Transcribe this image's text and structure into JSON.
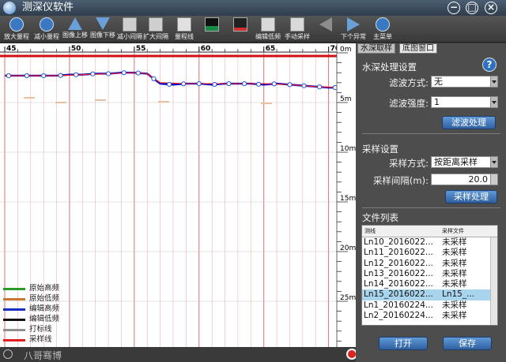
{
  "window": {
    "title": "测深仪软件",
    "controls": {
      "minimize": "−",
      "maximize": "□",
      "close": "×"
    }
  },
  "toolbar": [
    {
      "label": "放大量程",
      "icon": "zoom-in-icon"
    },
    {
      "label": "减小量程",
      "icon": "zoom-out-icon"
    },
    {
      "label": "图像上移",
      "icon": "arrow-up-icon"
    },
    {
      "label": "图像下移",
      "icon": "arrow-down-icon"
    },
    {
      "label": "减小间隔",
      "icon": "shrink-interval-icon"
    },
    {
      "label": "扩大间隔",
      "icon": "expand-interval-icon"
    },
    {
      "label": "量程线",
      "icon": "range-line-icon"
    },
    {
      "label": "",
      "icon": "waveform-icon"
    },
    {
      "label": "",
      "icon": "edit-line-icon"
    },
    {
      "label": "编辑低频",
      "icon": "edit-low-freq-icon"
    },
    {
      "label": "手动采样",
      "icon": "manual-sample-icon"
    },
    {
      "label": "",
      "icon": "prev-arrow-icon"
    },
    {
      "label": "下个异常",
      "icon": "next-arrow-icon"
    },
    {
      "label": "主菜单",
      "icon": "main-menu-icon"
    }
  ],
  "chart_data": {
    "type": "line",
    "title": "",
    "xlabel": "",
    "ylabel": "",
    "x_ticks": [
      "45",
      "50",
      "55",
      "60",
      "65",
      "70"
    ],
    "xlim": [
      45,
      71
    ],
    "depth_ticks": [
      "0m",
      "5m",
      "10m",
      "15m",
      "20m",
      "25m"
    ],
    "ylim": [
      0,
      30
    ],
    "grid": true,
    "series": [
      {
        "name": "编辑高频",
        "color": "#0000cc",
        "x": [
          45,
          46,
          47,
          48,
          49,
          50,
          51,
          52,
          53,
          54,
          55,
          56,
          57,
          58,
          59,
          60,
          61,
          62,
          63,
          64,
          65,
          66,
          67,
          68,
          69,
          70,
          71
        ],
        "y": [
          2.3,
          2.3,
          2.3,
          2.3,
          2.3,
          2.2,
          2.2,
          2.1,
          2.1,
          2.0,
          2.0,
          2.1,
          3.1,
          3.2,
          3.1,
          3.1,
          3.2,
          3.1,
          3.1,
          3.1,
          3.2,
          3.1,
          3.2,
          3.3,
          3.4,
          3.5,
          3.5
        ]
      },
      {
        "name": "采样线",
        "color": "#ee2222",
        "x": [
          45,
          47,
          49,
          51,
          53,
          55,
          56,
          57,
          59,
          61,
          63,
          65,
          67,
          69,
          71
        ],
        "y": [
          2.3,
          2.3,
          2.3,
          2.2,
          2.1,
          2.0,
          2.1,
          3.0,
          3.1,
          3.1,
          3.1,
          3.1,
          3.2,
          3.4,
          3.5
        ]
      }
    ],
    "sample_marks_x": [
      45.3,
      46.7,
      48.0,
      49.3,
      50.5,
      51.8,
      53.0,
      54.2,
      55.3,
      56.5,
      57.7,
      58.8,
      60.0,
      61.2,
      62.3,
      63.5,
      64.6,
      65.8,
      67.0,
      68.1,
      69.3,
      70.5
    ],
    "legend": [
      {
        "name": "原始高频",
        "color": "#2a9a2a"
      },
      {
        "name": "原始低频",
        "color": "#c87830"
      },
      {
        "name": "编辑高频",
        "color": "#1030c0"
      },
      {
        "name": "编辑低频",
        "color": "#101010"
      },
      {
        "name": "打标线",
        "color": "#909090"
      },
      {
        "name": "采样线",
        "color": "#e02020"
      }
    ]
  },
  "status": {
    "text": "八哥骞博"
  },
  "panel": {
    "tabs": [
      {
        "label": "水深取样",
        "active": true
      },
      {
        "label": "底图窗口",
        "active": false
      }
    ],
    "water": {
      "section": "水深处理设置",
      "filter_mode_label": "滤波方式:",
      "filter_mode_value": "无",
      "filter_strength_label": "滤波强度:",
      "filter_strength_value": "1",
      "process_button": "滤波处理"
    },
    "sample": {
      "section": "采样设置",
      "method_label": "采样方式:",
      "method_value": "按距离采样",
      "interval_label": "采样间隔(m):",
      "interval_value": "20.0",
      "process_button": "采样处理"
    },
    "files": {
      "section": "文件列表",
      "col1": "测线",
      "col2": "采样文件",
      "rows": [
        {
          "line": "Ln10_2016022...",
          "sample": "未采样",
          "selected": false
        },
        {
          "line": "Ln11_2016022...",
          "sample": "未采样",
          "selected": false
        },
        {
          "line": "Ln12_2016022...",
          "sample": "未采样",
          "selected": false
        },
        {
          "line": "Ln13_2016022...",
          "sample": "未采样",
          "selected": false
        },
        {
          "line": "Ln14_2016022...",
          "sample": "未采样",
          "selected": false
        },
        {
          "line": "Ln15_2016022...",
          "sample": "Ln15_...",
          "selected": true
        },
        {
          "line": "Ln1_20160224...",
          "sample": "未采样",
          "selected": false
        },
        {
          "line": "Ln2_20160224...",
          "sample": "未采样",
          "selected": false
        }
      ]
    },
    "open_button": "打开",
    "save_button": "保存"
  },
  "colors": {
    "accent": "#3a78c2",
    "selection": "#a9d4ee"
  }
}
